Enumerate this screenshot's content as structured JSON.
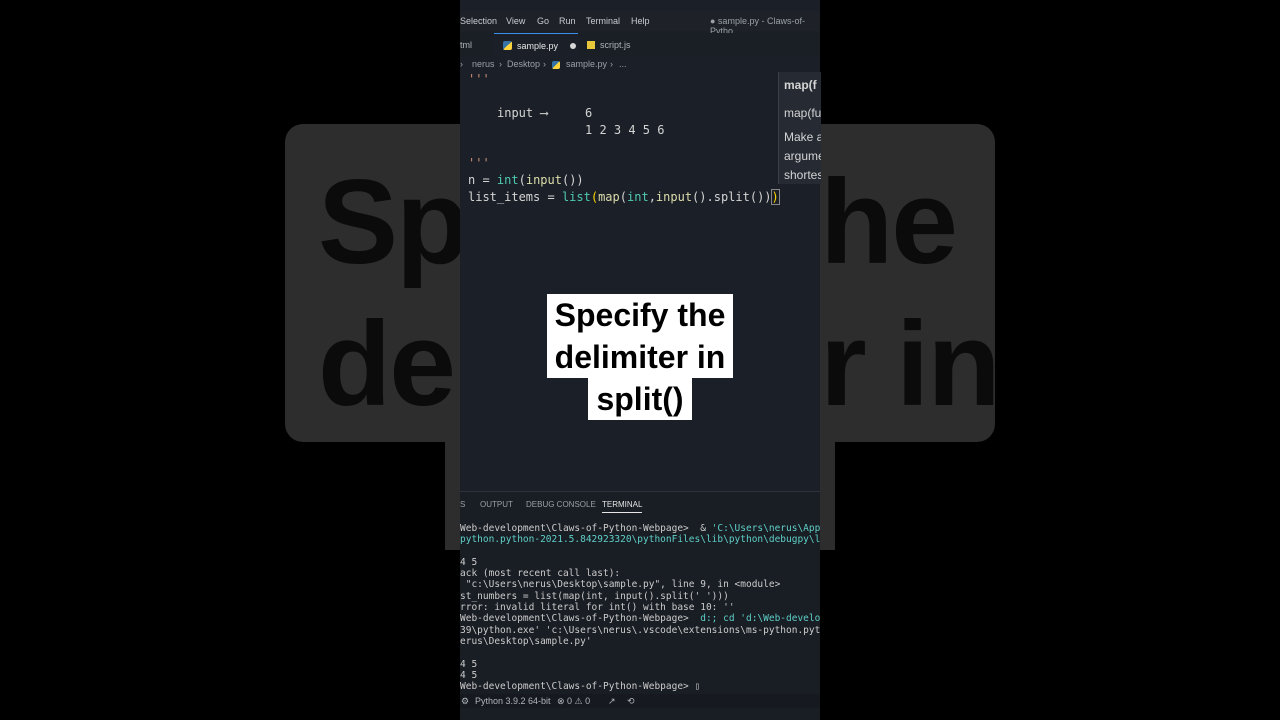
{
  "background": {
    "line1_left": "Sp",
    "line2_left": "de",
    "line1_right": "he",
    "line2_right": "r in"
  },
  "menu": {
    "items": [
      "Selection",
      "View",
      "Go",
      "Run",
      "Terminal",
      "Help"
    ],
    "title": "● sample.py - Claws-of-Pytho"
  },
  "tabs": [
    {
      "label": "tml"
    },
    {
      "label": "sample.py",
      "modified": true
    },
    {
      "label": "script.js"
    }
  ],
  "breadcrumb": {
    "items": [
      "nerus",
      "Desktop",
      "sample.py",
      "..."
    ],
    "separator": "›"
  },
  "code": {
    "doc_open": "'''",
    "input_label": "input",
    "arrow": "⟶",
    "input_n": "6",
    "input_values": "1 2 3 4 5 6",
    "doc_close": "'''",
    "line_n_var": "n",
    "line_n_eq": " = ",
    "line_n_int": "int",
    "line_n_open": "(",
    "line_n_input": "input",
    "line_n_close": "())",
    "line_list_var": "list_items",
    "line_list_eq": " = ",
    "line_list_list": "list",
    "line_list_p1": "(",
    "line_list_map": "map",
    "line_list_args_open": "(",
    "line_list_int": "int",
    "line_list_comma": ",",
    "line_list_input": "input",
    "line_list_split": "().split())",
    "line_list_p2": ")"
  },
  "hover": {
    "signature": "map(f",
    "line2": "map(fu",
    "line3": "Make a",
    "line4": "argume",
    "line5": "shortes"
  },
  "caption": {
    "lines": [
      "Specify the",
      "delimiter in",
      "split()"
    ]
  },
  "panel": {
    "tabs": [
      "S",
      "OUTPUT",
      "DEBUG CONSOLE",
      "TERMINAL"
    ],
    "active_tab": "TERMINAL"
  },
  "terminal": {
    "l1a": "Web-development\\Claws-of-Python-Webpage>  & ",
    "l1b": "'C:\\Users\\nerus\\AppDa",
    "l2": "python.python-2021.5.842923320\\pythonFiles\\lib\\python\\debugpy\\lau",
    "l3": "",
    "l4": "4 5",
    "l5": "ack (most recent call last):",
    "l6": " \"c:\\Users\\nerus\\Desktop\\sample.py\", line 9, in <module>",
    "l7": "st_numbers = list(map(int, input().split(' ')))",
    "l8": "rror: invalid literal for int() with base 10: ''",
    "l9a": "Web-development\\Claws-of-Python-Webpage>  ",
    "l9b": "d:; cd 'd:\\Web-developm",
    "l10": "39\\python.exe' 'c:\\Users\\nerus\\.vscode\\extensions\\ms-python.pytho",
    "l11": "erus\\Desktop\\sample.py'",
    "l12": "",
    "l13": "4 5",
    "l14": "4 5",
    "l15": "Web-development\\Claws-of-Python-Webpage> ▯"
  },
  "status": {
    "python": "Python 3.9.2 64-bit",
    "problems": "⊗ 0 ⚠ 0"
  }
}
